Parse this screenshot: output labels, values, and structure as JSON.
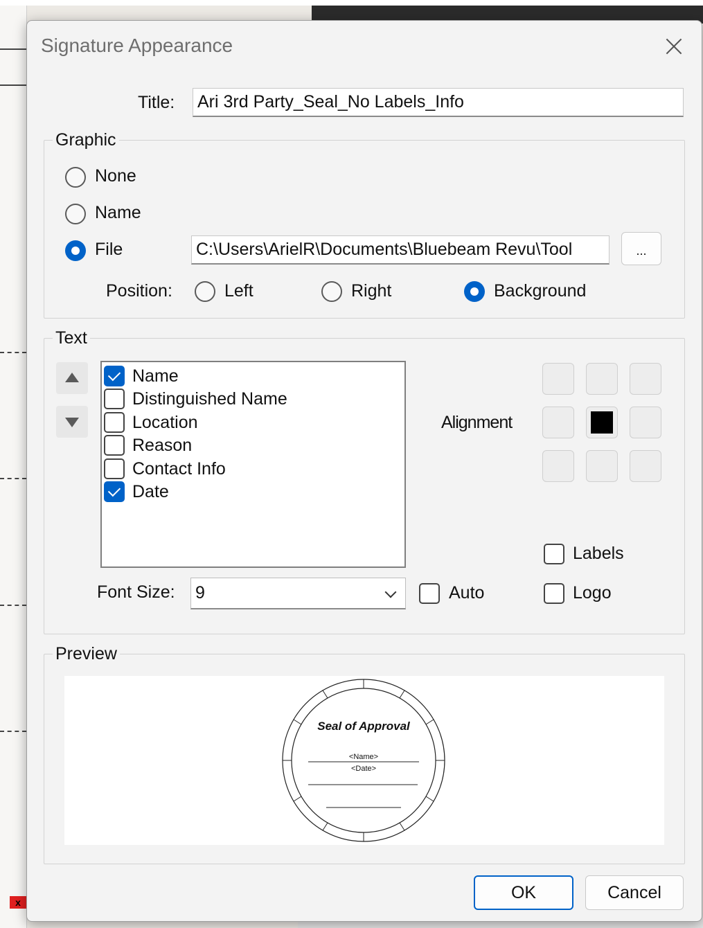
{
  "dialog": {
    "title": "Signature Appearance"
  },
  "title_field": {
    "label": "Title:",
    "value": "Ari 3rd Party_Seal_No Labels_Info"
  },
  "graphic": {
    "legend": "Graphic",
    "options": [
      {
        "label": "None",
        "selected": false
      },
      {
        "label": "Name",
        "selected": false
      },
      {
        "label": "File",
        "selected": true
      }
    ],
    "file_path": "C:\\Users\\ArielR\\Documents\\Bluebeam Revu\\Tool",
    "browse_label": "...",
    "position_label": "Position:",
    "positions": [
      {
        "label": "Left",
        "selected": false
      },
      {
        "label": "Right",
        "selected": false
      },
      {
        "label": "Background",
        "selected": true
      }
    ]
  },
  "text": {
    "legend": "Text",
    "items": [
      {
        "label": "Name",
        "checked": true
      },
      {
        "label": "Distinguished Name",
        "checked": false
      },
      {
        "label": "Location",
        "checked": false
      },
      {
        "label": "Reason",
        "checked": false
      },
      {
        "label": "Contact Info",
        "checked": false
      },
      {
        "label": "Date",
        "checked": true
      }
    ],
    "alignment_label": "Alignment",
    "alignment_selected": "middle-center",
    "font_size_label": "Font Size:",
    "font_size_value": "9",
    "auto_label": "Auto",
    "labels_label": "Labels",
    "logo_label": "Logo"
  },
  "preview": {
    "legend": "Preview",
    "seal_title": "Seal of Approval",
    "seal_name": "<Name>",
    "seal_date": "<Date>"
  },
  "buttons": {
    "ok": "OK",
    "cancel": "Cancel"
  }
}
